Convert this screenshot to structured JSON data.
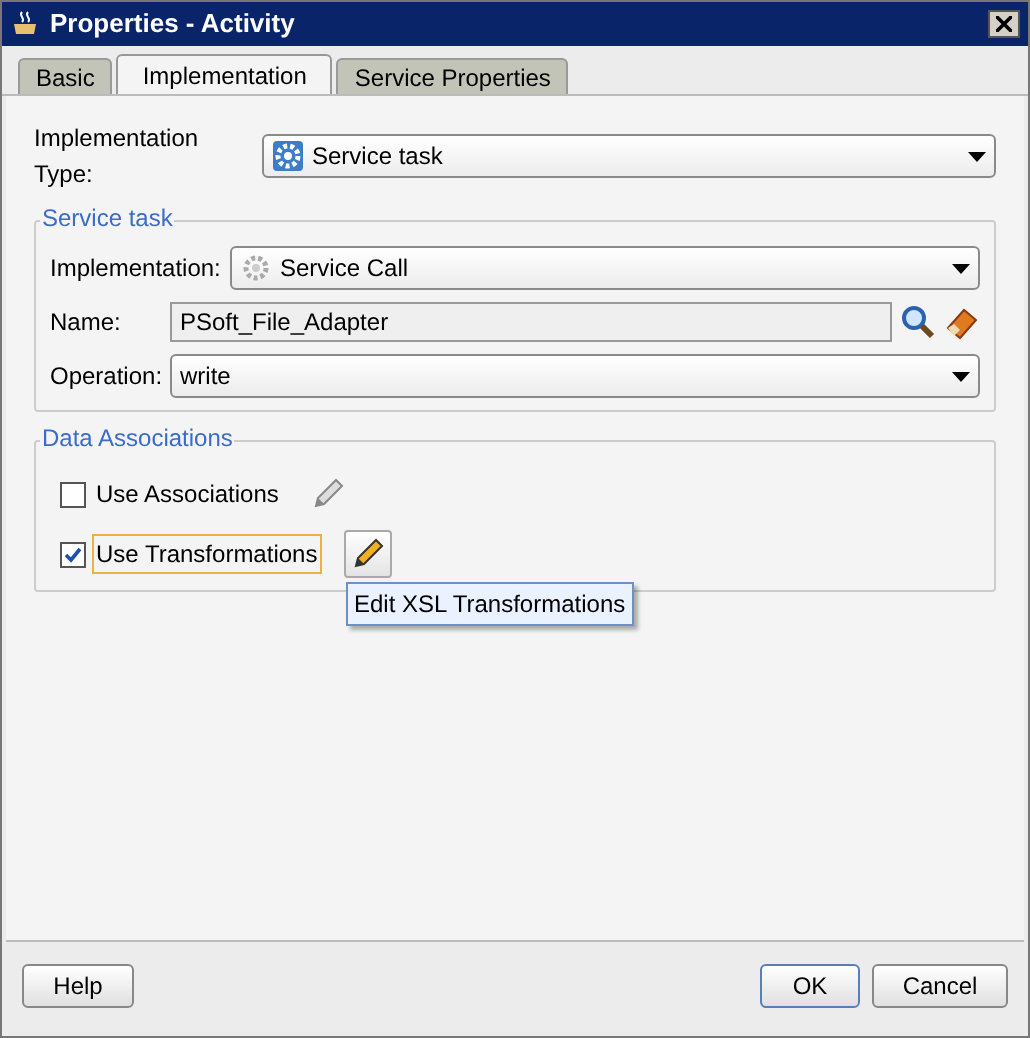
{
  "window": {
    "title": "Properties - Activity"
  },
  "tabs": [
    {
      "label": "Basic",
      "selected": false
    },
    {
      "label": "Implementation",
      "selected": true
    },
    {
      "label": "Service Properties",
      "selected": false
    }
  ],
  "implementation_type": {
    "label": "Implementation Type:",
    "value": "Service task"
  },
  "service_task": {
    "title": "Service task",
    "implementation": {
      "label": "Implementation:",
      "value": "Service Call"
    },
    "name": {
      "label": "Name:",
      "value": "PSoft_File_Adapter"
    },
    "operation": {
      "label": "Operation:",
      "value": "write"
    }
  },
  "data_associations": {
    "title": "Data Associations",
    "options": [
      {
        "label": "Use Associations",
        "checked": false,
        "focused": false,
        "edit_enabled": false
      },
      {
        "label": "Use Transformations",
        "checked": true,
        "focused": true,
        "edit_enabled": true
      }
    ],
    "tooltip": "Edit XSL Transformations"
  },
  "buttons": {
    "help": "Help",
    "ok": "OK",
    "cancel": "Cancel"
  }
}
